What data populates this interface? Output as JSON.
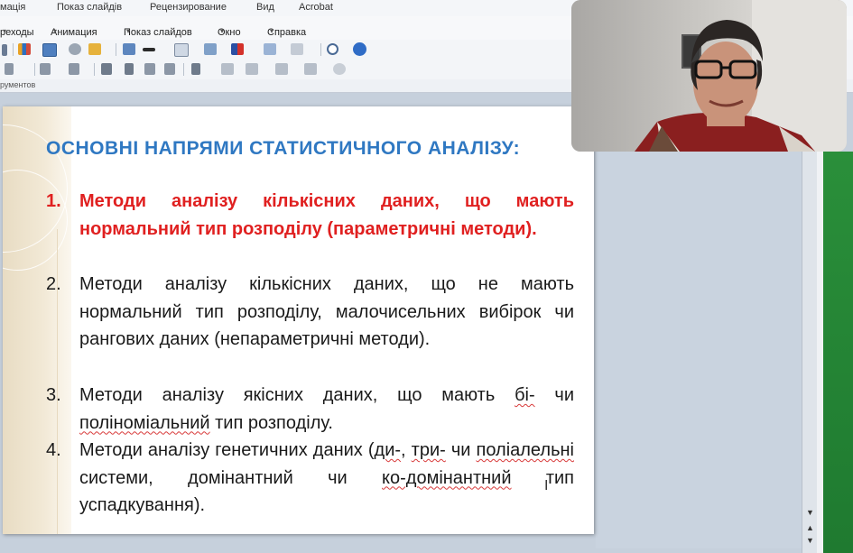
{
  "ribbon_tabs": [
    "мація",
    "Показ слайдів",
    "Рецензирование",
    "Вид",
    "Acrobat"
  ],
  "menu_items": [
    {
      "label": "реходы",
      "caret": "▾"
    },
    {
      "label": "Анимация",
      "caret": "▾"
    },
    {
      "label": "Показ слайдов",
      "caret": "▾"
    },
    {
      "label": "Окно",
      "caret": "▾"
    },
    {
      "label": "Справка",
      "caret": "▾"
    }
  ],
  "toolbar_group_label": "рументов",
  "slide": {
    "title": "ОСНОВНІ НАПРЯМИ СТАТИСТИЧНОГО АНАЛІЗУ:",
    "items": [
      {
        "num": "1.",
        "text": "Методи аналізу кількісних даних, що мають нормальний тип розподілу (параметричні методи)."
      },
      {
        "num": "2.",
        "text": "Методи аналізу кількісних даних, що не мають нормальний тип розподілу, малочисельних вибірок чи рангових даних (непараметричні методи)."
      },
      {
        "num": "3.",
        "text_before": "Методи аналізу якісних даних, що мають ",
        "flag1": "бі-",
        "text_mid": " чи ",
        "flag2": "поліноміальний",
        "text_after": " тип розподілу."
      },
      {
        "num": "4.",
        "text_before": "Методи аналізу генетичних даних (",
        "flag1": "ди-",
        "text_mid": ", ",
        "flag2": "три-",
        "text_mid2": " чи ",
        "flag3": "поліалельні",
        "text_mid3": " системи, домінантний чи ",
        "flag4": "ко-домінантний",
        "text_after": " тип успадкування)."
      }
    ]
  },
  "colors": {
    "title": "#2f78c2",
    "highlight_item": "#e02020"
  },
  "icons": [
    "cut-icon",
    "chart-icon",
    "table-icon",
    "clipart-icon",
    "folder-icon",
    "grid-icon",
    "line-icon",
    "new-slide-icon",
    "layout-icon",
    "color-icon",
    "copy-icon",
    "print-icon",
    "zoom-icon",
    "help-icon",
    "align-icon",
    "bullets-icon",
    "font-size-icon",
    "text-icon",
    "shapes-icon",
    "webcam-person"
  ]
}
